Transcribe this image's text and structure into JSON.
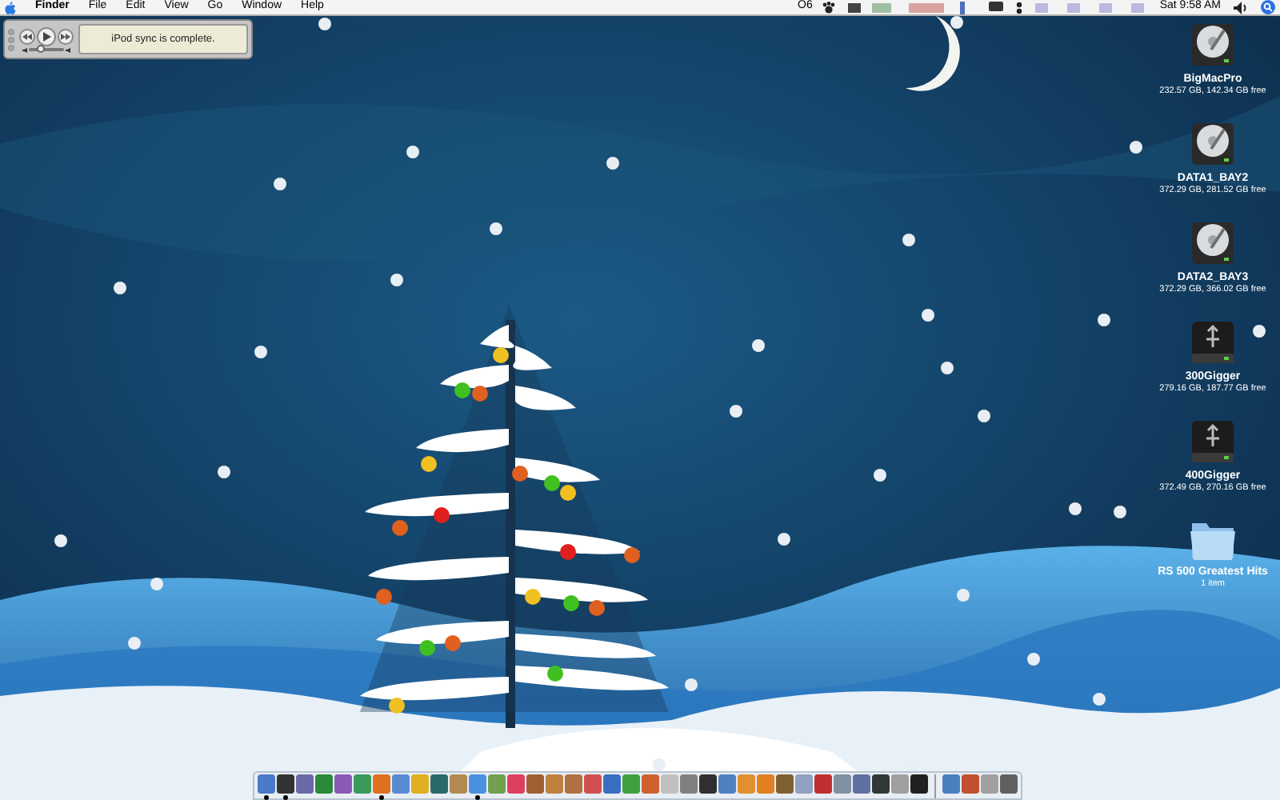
{
  "menu_bar": {
    "app_name": "Finder",
    "menus": [
      "File",
      "Edit",
      "View",
      "Go",
      "Window",
      "Help"
    ],
    "status_text": "O6",
    "clock": "Sat 9:58 AM"
  },
  "itunes_widget": {
    "display": "iPod sync is complete.",
    "volume": {
      "level": 0.35
    }
  },
  "desktop_icons": [
    {
      "kind": "internal-drive",
      "name": "BigMacPro",
      "detail": "232.57 GB, 142.34 GB free"
    },
    {
      "kind": "internal-drive",
      "name": "DATA1_BAY2",
      "detail": "372.29 GB, 281.52 GB free"
    },
    {
      "kind": "internal-drive",
      "name": "DATA2_BAY3",
      "detail": "372.29 GB, 366.02 GB free"
    },
    {
      "kind": "external-drive",
      "name": "300Gigger",
      "detail": "279.16 GB, 187.77 GB free"
    },
    {
      "kind": "external-drive",
      "name": "400Gigger",
      "detail": "372.49 GB, 270.16 GB free"
    },
    {
      "kind": "folder",
      "name": "RS 500 Greatest Hits",
      "detail": "1 item"
    }
  ],
  "dock": {
    "apps": [
      {
        "running": true
      },
      {
        "running": true
      },
      {
        "running": false
      },
      {
        "running": false
      },
      {
        "running": false
      },
      {
        "running": false
      },
      {
        "running": true
      },
      {
        "running": false
      },
      {
        "running": false
      },
      {
        "running": false
      },
      {
        "running": false
      },
      {
        "running": true
      },
      {
        "running": false
      },
      {
        "running": false
      },
      {
        "running": false
      },
      {
        "running": false
      },
      {
        "running": false
      },
      {
        "running": false
      },
      {
        "running": false
      },
      {
        "running": false
      },
      {
        "running": false
      },
      {
        "running": false
      },
      {
        "running": false
      },
      {
        "running": false
      },
      {
        "running": false
      },
      {
        "running": false
      },
      {
        "running": false
      },
      {
        "running": false
      },
      {
        "running": false
      },
      {
        "running": false
      },
      {
        "running": false
      },
      {
        "running": false
      },
      {
        "running": false
      },
      {
        "running": false
      },
      {
        "running": false
      }
    ],
    "stacks": [
      {
        "running": false
      },
      {
        "running": false
      },
      {
        "running": false
      },
      {
        "running": false
      }
    ]
  }
}
